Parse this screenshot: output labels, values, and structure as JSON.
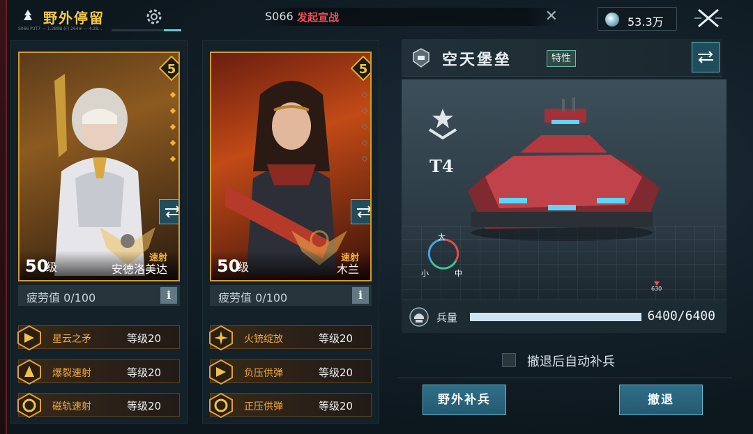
{
  "header": {
    "title": "野外停留",
    "subtitle": "S066 P3T7 — 1.289B (F) 264# — 4.28...",
    "notice_num": "S066",
    "notice_text": "发起宣战",
    "currency_value": "53.3万"
  },
  "heroes": [
    {
      "rarity": "5",
      "level": "50",
      "level_unit": "级",
      "role": "速射",
      "name": "安德洛美达",
      "fatigue": "疲劳值 0/100",
      "info": "i",
      "skills": [
        {
          "name": "星云之矛",
          "level": "等级20"
        },
        {
          "name": "爆裂速射",
          "level": "等级20"
        },
        {
          "name": "磁轨速射",
          "level": "等级20"
        }
      ]
    },
    {
      "rarity": "5",
      "level": "50",
      "level_unit": "级",
      "role": "速射",
      "name": "木兰",
      "fatigue": "疲劳值 0/100",
      "info": "i",
      "skills": [
        {
          "name": "火铳绽放",
          "level": "等级20"
        },
        {
          "name": "负压供弹",
          "level": "等级20"
        },
        {
          "name": "正压供弹",
          "level": "等级20"
        }
      ]
    }
  ],
  "unit": {
    "name": "空天堡垒",
    "trait_label": "特性",
    "tier": "T4",
    "size_big": "大",
    "size_small": "小",
    "size_mid": "中",
    "marker": "630",
    "troops_label": "兵量",
    "troops_value": "6400/6400",
    "troops_fill": 1.0
  },
  "actions": {
    "auto_resupply_label": "撤退后自动补兵",
    "resupply_button": "野外补兵",
    "retreat_button": "撤退"
  },
  "colors": {
    "accent_gold": "#f1c847",
    "skill_orange": "#f4a83b",
    "notice_red": "#ef4d56",
    "button_blue": "#2f6e88"
  }
}
